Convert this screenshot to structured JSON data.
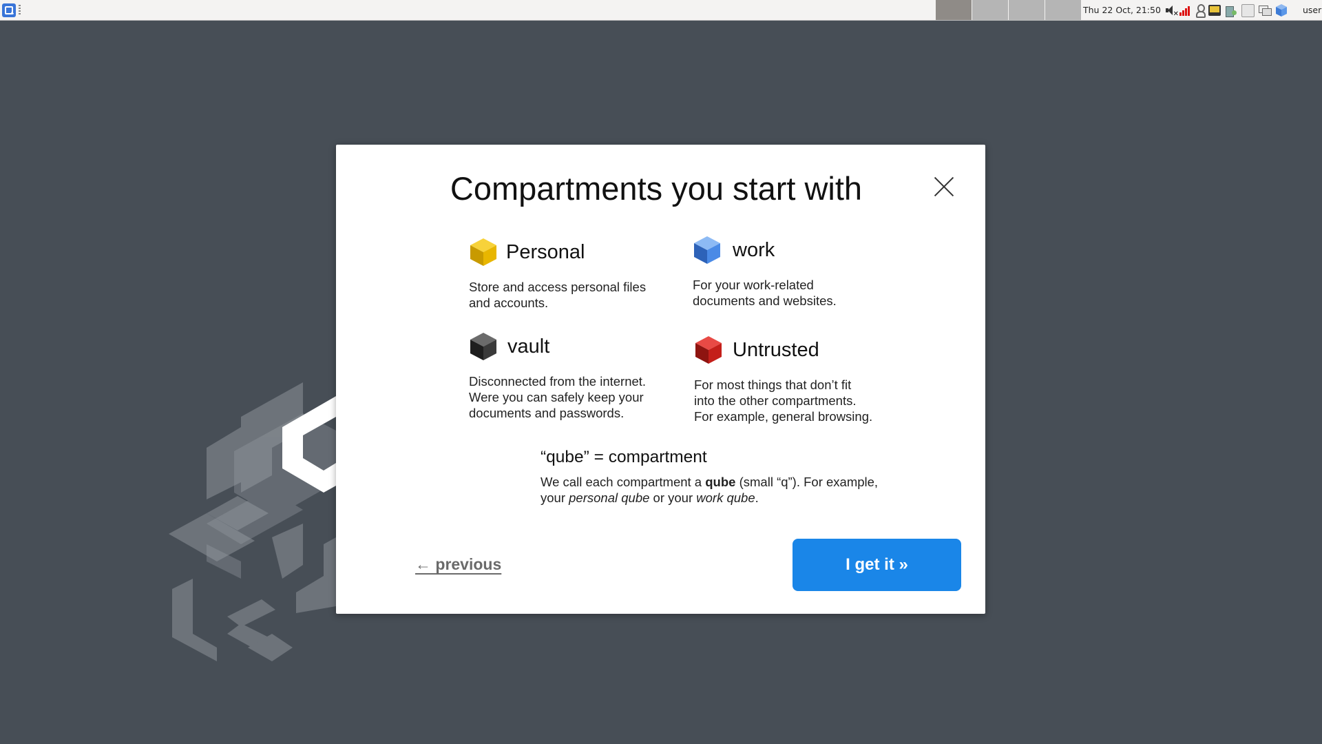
{
  "panel": {
    "clock": "Thu 22 Oct, 21:50",
    "user": "user",
    "workspaces": [
      "",
      "",
      "",
      ""
    ],
    "tray_icons": [
      "volume-muted-icon",
      "network-signal-icon",
      "user-status-icon",
      "display-icon",
      "devices-icon",
      "disk-icon",
      "windows-icon",
      "qube-cube-icon"
    ]
  },
  "dialog": {
    "title": "Compartments you start with",
    "compartments": [
      {
        "name": "Personal",
        "description": "Store and access personal files\nand accounts.",
        "color": "#f2c100"
      },
      {
        "name": "work",
        "description": "For your work-related\ndocuments and websites.",
        "color": "#4a8ae6"
      },
      {
        "name": "vault",
        "description": "Disconnected from the internet.\nWere you can safely keep your\ndocuments and passwords.",
        "color": "#3a3a3a"
      },
      {
        "name": "Untrusted",
        "description": "For most things that don’t fit\ninto the other compartments.\nFor example, general browsing.",
        "color": "#d0201d"
      }
    ],
    "qube_note": {
      "heading": "“qube” = compartment",
      "expl_1": "We call each compartment a ",
      "expl_bold": "qube",
      "expl_2": " (small “q”). For example, your ",
      "expl_italic_1": "personal qube",
      "expl_3": " or your ",
      "expl_italic_2": "work qube",
      "expl_4": "."
    },
    "previous_label": "← previous",
    "primary_label": "I get it »"
  },
  "colors": {
    "background": "#474e56",
    "accent": "#1a86e8"
  }
}
